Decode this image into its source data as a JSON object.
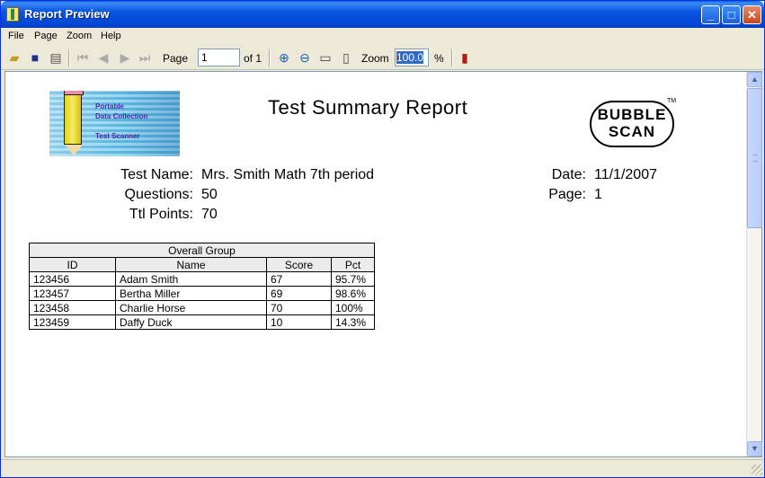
{
  "window": {
    "title": "Report Preview"
  },
  "menu": [
    "File",
    "Page",
    "Zoom",
    "Help"
  ],
  "toolbar": {
    "page_label": "Page",
    "page_value": "1",
    "page_of": "of 1",
    "zoom_label": "Zoom",
    "zoom_value": "100.0",
    "zoom_unit": "%"
  },
  "report": {
    "title": "Test Summary Report",
    "logo_left": {
      "lines": [
        "Portable",
        "Data Collection",
        "Test Scanner"
      ]
    },
    "logo_right": {
      "line1": "BUBBLE",
      "line2": "SCAN",
      "tm": "TM"
    },
    "test_name_label": "Test Name:",
    "test_name": "Mrs. Smith Math 7th period",
    "questions_label": "Questions:",
    "questions": "50",
    "total_points_label": "Ttl Points:",
    "total_points": "70",
    "date_label": "Date:",
    "date": "11/1/2007",
    "page_label": "Page:",
    "page": "1",
    "table": {
      "group_title": "Overall  Group",
      "columns": [
        "ID",
        "Name",
        "Score",
        "Pct"
      ],
      "rows": [
        [
          "123456",
          "Adam  Smith",
          "67",
          "95.7%"
        ],
        [
          "123457",
          "Bertha  Miller",
          "69",
          "98.6%"
        ],
        [
          "123458",
          "Charlie  Horse",
          "70",
          "100%"
        ],
        [
          "123459",
          "Daffy  Duck",
          "10",
          "14.3%"
        ]
      ]
    }
  },
  "colors": {
    "title_bar": "#0a5fe6",
    "selection": "#316ac5"
  }
}
